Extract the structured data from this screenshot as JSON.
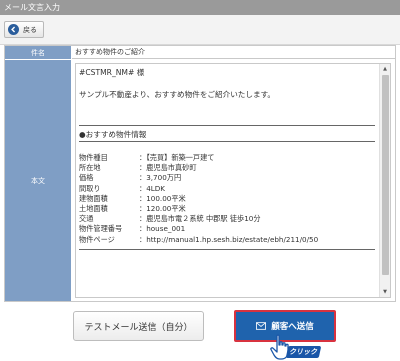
{
  "window": {
    "title": "メール文言入力"
  },
  "toolbar": {
    "back_label": "戻る"
  },
  "form": {
    "subject_label": "件名",
    "subject_value": "おすすめ物件のご紹介",
    "body_label": "本文",
    "body": {
      "salutation": "#CSTMR_NM# 様",
      "intro": "サンプル不動産より、おすすめ物件をご紹介いたします。",
      "section_title": "●おすすめ物件情報",
      "details": [
        {
          "key": "物件種目",
          "value": "：【売買】新築一戸建て"
        },
        {
          "key": "所在地",
          "value": "：鹿児島市真砂町"
        },
        {
          "key": "価格",
          "value": "：3,700万円"
        },
        {
          "key": "間取り",
          "value": "：4LDK"
        },
        {
          "key": "建物面積",
          "value": "：100.00平米"
        },
        {
          "key": "土地面積",
          "value": "：120.00平米"
        },
        {
          "key": "交通",
          "value": "：鹿児島市電２系統 中郡駅 徒歩10分"
        },
        {
          "key": "物件管理番号",
          "value": "：house_001"
        },
        {
          "key": "物件ページ",
          "value": "：http://manual1.hp.sesh.biz/estate/ebh/211/0/50"
        }
      ]
    }
  },
  "buttons": {
    "test_send": "テストメール送信（自分）",
    "send_to_customer": "顧客へ送信"
  },
  "callout": {
    "label": "クリック"
  },
  "colors": {
    "label_bg": "#7f9ec5",
    "send_bg": "#1f63ad",
    "send_border": "#d8323f",
    "title_bg": "#9a9a9a"
  }
}
